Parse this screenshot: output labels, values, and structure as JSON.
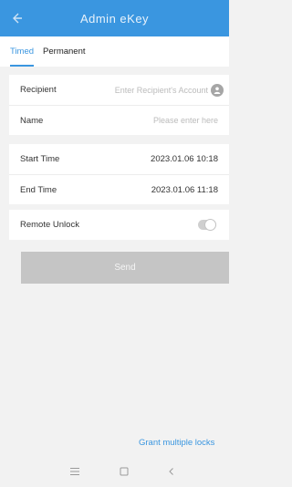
{
  "header": {
    "title": "Admin eKey"
  },
  "tabs": [
    {
      "label": "Timed",
      "active": true
    },
    {
      "label": "Permanent",
      "active": false
    }
  ],
  "recipient": {
    "label": "Recipient",
    "placeholder": "Enter Recipient's Account"
  },
  "name": {
    "label": "Name",
    "placeholder": "Please enter here"
  },
  "start_time": {
    "label": "Start Time",
    "value": "2023.01.06 10:18"
  },
  "end_time": {
    "label": "End Time",
    "value": "2023.01.06 11:18"
  },
  "remote_unlock": {
    "label": "Remote Unlock",
    "enabled": false
  },
  "send_label": "Send",
  "grant_multiple_label": "Grant multiple locks",
  "colors": {
    "accent": "#3a96e0",
    "button_disabled": "#c5c5c5"
  },
  "icons": [
    "back-arrow-icon",
    "contact-icon",
    "menu-icon",
    "home-square-icon",
    "back-chevron-icon"
  ]
}
